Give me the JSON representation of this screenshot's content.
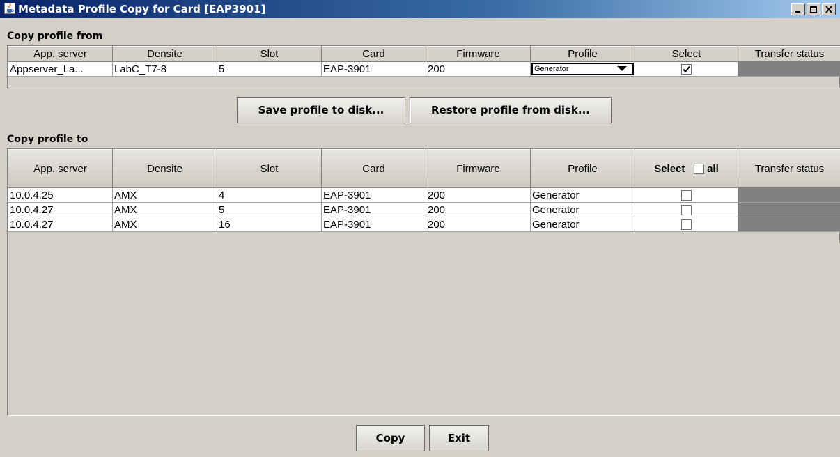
{
  "window": {
    "title": "Metadata Profile Copy for Card [EAP3901]"
  },
  "from": {
    "label": "Copy profile from",
    "columns": [
      "App. server",
      "Densite",
      "Slot",
      "Card",
      "Firmware",
      "Profile",
      "Select",
      "Transfer status"
    ],
    "row": {
      "app_server": "Appserver_La...",
      "densite": "LabC_T7-8",
      "slot": "5",
      "card": "EAP-3901",
      "firmware": "200",
      "profile": "Generator",
      "selected": true,
      "transfer_status": ""
    }
  },
  "buttons": {
    "save": "Save profile to disk...",
    "restore": "Restore profile from disk...",
    "copy": "Copy",
    "exit": "Exit"
  },
  "to": {
    "label": "Copy profile to",
    "columns": [
      "App. server",
      "Densite",
      "Slot",
      "Card",
      "Firmware",
      "Profile",
      "Select",
      "Transfer status"
    ],
    "select_all_label": "all",
    "rows": [
      {
        "app_server": "10.0.4.25",
        "densite": "AMX",
        "slot": "4",
        "card": "EAP-3901",
        "firmware": "200",
        "profile": "Generator",
        "selected": false
      },
      {
        "app_server": "10.0.4.27",
        "densite": "AMX",
        "slot": "5",
        "card": "EAP-3901",
        "firmware": "200",
        "profile": "Generator",
        "selected": false
      },
      {
        "app_server": "10.0.4.27",
        "densite": "AMX",
        "slot": "16",
        "card": "EAP-3901",
        "firmware": "200",
        "profile": "Generator",
        "selected": false
      }
    ]
  },
  "colors": {
    "panel": "#d4d0c8",
    "title_start": "#0a246a",
    "title_end": "#a6caf0",
    "status_cell": "#808080"
  },
  "icons": [
    "java-cup-icon",
    "minimize-icon",
    "maximize-icon",
    "close-icon",
    "checkbox-icon",
    "dropdown-arrow-icon"
  ]
}
